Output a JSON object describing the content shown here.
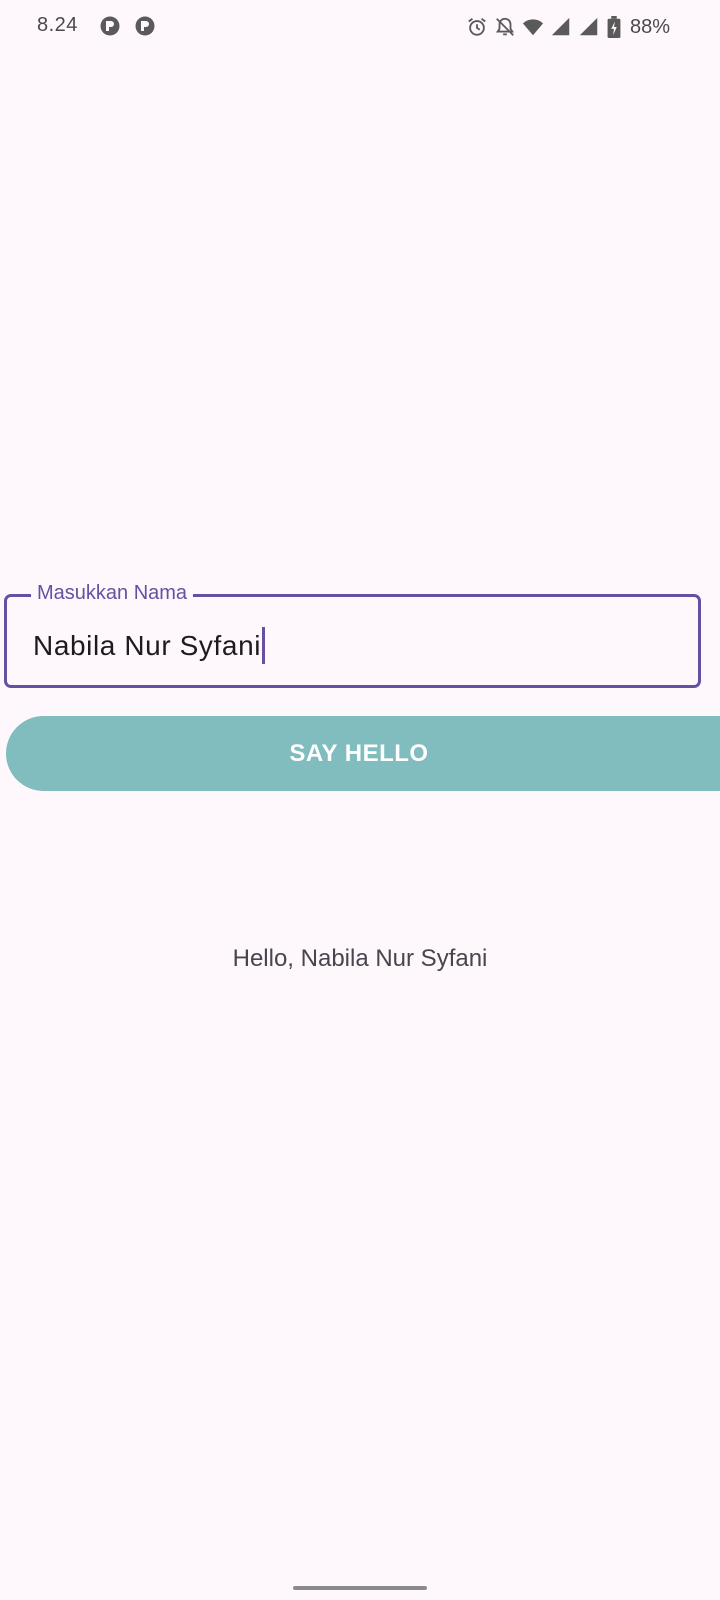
{
  "status_bar": {
    "time": "8.24",
    "battery_percent": "88%",
    "icons": [
      "notification-app-icon",
      "notification-app-icon",
      "alarm-icon",
      "notifications-off-icon",
      "wifi-icon",
      "signal-icon",
      "signal-icon",
      "battery-charging-icon"
    ]
  },
  "form": {
    "name_field": {
      "label": "Masukkan Nama",
      "value": "Nabila Nur Syfani"
    },
    "say_hello_button": {
      "label": "SAY HELLO",
      "color": "#81bdbe"
    }
  },
  "greeting": {
    "text": "Hello, Nabila Nur Syfani"
  },
  "colors": {
    "background": "#fef7fc",
    "accent": "#6750a4",
    "button": "#81bdbe"
  }
}
